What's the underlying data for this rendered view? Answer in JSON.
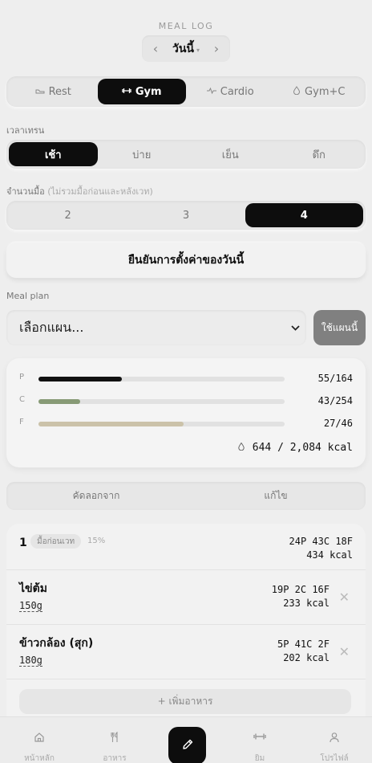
{
  "header": {
    "title": "MEAL LOG",
    "date_label": "วันนี้",
    "prev_icon": "chevron-left-icon",
    "next_icon": "chevron-right-icon"
  },
  "workout_types": [
    {
      "label": "Rest",
      "icon": "shoe-icon",
      "active": false
    },
    {
      "label": "Gym",
      "icon": "dumbbell-icon",
      "active": true
    },
    {
      "label": "Cardio",
      "icon": "pulse-icon",
      "active": false
    },
    {
      "label": "Gym+C",
      "icon": "flame-icon",
      "active": false
    }
  ],
  "training_time": {
    "label": "เวลาเทรน",
    "options": [
      {
        "label": "เช้า",
        "active": true
      },
      {
        "label": "บ่าย",
        "active": false
      },
      {
        "label": "เย็น",
        "active": false
      },
      {
        "label": "ดึก",
        "active": false
      }
    ]
  },
  "meal_count": {
    "label": "จำนวนมื้อ",
    "sublabel": "(ไม่รวมมื้อก่อนและหลังเวท)",
    "options": [
      {
        "label": "2",
        "active": false
      },
      {
        "label": "3",
        "active": false
      },
      {
        "label": "4",
        "active": true
      }
    ]
  },
  "confirm_label": "ยืนยันการตั้งค่าของวันนี้",
  "meal_plan": {
    "label": "Meal plan",
    "placeholder": "เลือกแผน...",
    "use_button": "ใช้แผนนี้"
  },
  "macros": [
    {
      "letter": "P",
      "current": 55,
      "target": 164,
      "text": "55/164",
      "color": "#111111",
      "fill_pct": 34
    },
    {
      "letter": "C",
      "current": 43,
      "target": 254,
      "text": "43/254",
      "color": "#879a76",
      "fill_pct": 17
    },
    {
      "letter": "F",
      "current": 27,
      "target": 46,
      "text": "27/46",
      "color": "#cbc2a9",
      "fill_pct": 59
    }
  ],
  "kcal_total": "644 / 2,084 kcal",
  "actions": {
    "copy_from": "คัดลอกจาก",
    "edit": "แก้ไข"
  },
  "meal": {
    "number": "1",
    "tag": "มื้อก่อนเวท",
    "percent": "15%",
    "macros": "24P 43C 18F",
    "kcal": "434 kcal",
    "foods": [
      {
        "name": "ไข่ต้ม",
        "grams": "150g",
        "macros": "19P 2C 16F",
        "kcal": "233 kcal"
      },
      {
        "name": "ข้าวกล้อง (สุก)",
        "grams": "180g",
        "macros": "5P 41C 2F",
        "kcal": "202 kcal"
      }
    ],
    "add_food": "+ เพิ่มอาหาร"
  },
  "nav": {
    "items": [
      {
        "label": "หน้าหลัก",
        "icon": "home-icon"
      },
      {
        "label": "อาหาร",
        "icon": "utensils-icon"
      },
      {
        "label": "ยิม",
        "icon": "dumbbell-icon"
      },
      {
        "label": "โปรไฟล์",
        "icon": "user-icon"
      }
    ],
    "fab_icon": "pencil-icon"
  }
}
